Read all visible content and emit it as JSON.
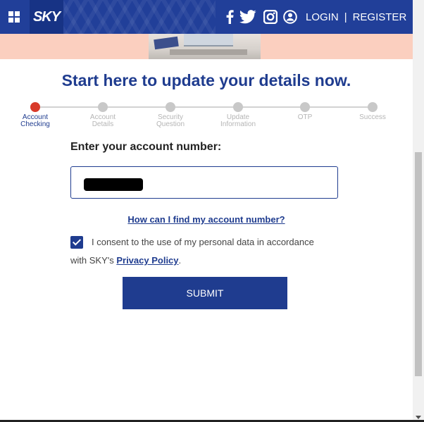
{
  "header": {
    "menu_icon": "grid-icon",
    "logo_text": "SKY",
    "social_icons": [
      "facebook-icon",
      "twitter-icon",
      "instagram-icon",
      "user-icon"
    ],
    "login_label": "LOGIN",
    "separator": "|",
    "register_label": "REGISTER"
  },
  "main": {
    "title": "Start here to update your details now.",
    "steps": [
      {
        "label_line1": "Account",
        "label_line2": "Checking"
      },
      {
        "label_line1": "Account",
        "label_line2": "Details"
      },
      {
        "label_line1": "Security",
        "label_line2": "Question"
      },
      {
        "label_line1": "Update",
        "label_line2": "Information"
      },
      {
        "label_line1": "OTP",
        "label_line2": ""
      },
      {
        "label_line1": "Success",
        "label_line2": ""
      }
    ],
    "active_step": 1,
    "account_label": "Enter your account number:",
    "help_link": "How can I find my account number?",
    "consent": {
      "checked": true,
      "text_line1": "I consent to the use of my personal data in accordance",
      "text_line2_prefix": "with SKY's ",
      "privacy_link": "Privacy Policy",
      "text_line2_suffix": "."
    },
    "submit_label": "SUBMIT"
  },
  "colors": {
    "brand_blue": "#1f3c8f",
    "nav_blue": "#213f99",
    "active_step": "#d83a2a",
    "hero_bg": "#fbcfbf"
  }
}
